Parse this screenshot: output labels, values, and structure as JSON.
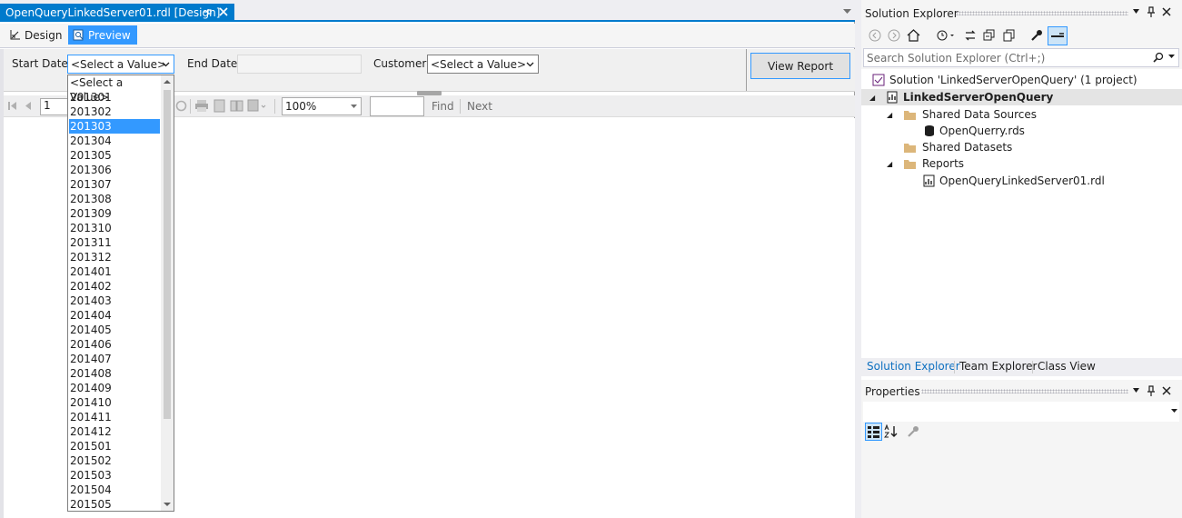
{
  "document_tab": {
    "title": "OpenQueryLinkedServer01.rdl [Design]"
  },
  "view_tabs": {
    "design": "Design",
    "preview": "Preview"
  },
  "parameters": {
    "start_date_label": "Start Date",
    "start_date_value": "<Select a Value>",
    "end_date_label": "End Date",
    "customer_label": "Customer",
    "customer_value": "<Select a Value>",
    "view_report": "View Report"
  },
  "start_date_options": [
    "<Select a Value>",
    "201301",
    "201302",
    "201303",
    "201304",
    "201305",
    "201306",
    "201307",
    "201308",
    "201309",
    "201310",
    "201311",
    "201312",
    "201401",
    "201402",
    "201403",
    "201404",
    "201405",
    "201406",
    "201407",
    "201408",
    "201409",
    "201410",
    "201411",
    "201412",
    "201501",
    "201502",
    "201503",
    "201504",
    "201505"
  ],
  "start_date_selected": "201303",
  "report_toolbar": {
    "page": "1",
    "zoom": "100%",
    "find": "Find",
    "next": "Next"
  },
  "solution_explorer": {
    "title": "Solution Explorer",
    "search_placeholder": "Search Solution Explorer (Ctrl+;)",
    "solution": "Solution 'LinkedServerOpenQuery' (1 project)",
    "project": "LinkedServerOpenQuery",
    "shared_data_sources": "Shared Data Sources",
    "data_source_file": "OpenQuerry.rds",
    "shared_datasets": "Shared Datasets",
    "reports": "Reports",
    "report_file": "OpenQueryLinkedServer01.rdl"
  },
  "bottom_tabs": {
    "solution_explorer": "Solution Explorer",
    "team_explorer": "Team Explorer",
    "class_view": "Class View"
  },
  "properties": {
    "title": "Properties"
  },
  "colors": {
    "accent": "#007acc",
    "selection": "#3399ff",
    "panel": "#f5f5f5"
  }
}
